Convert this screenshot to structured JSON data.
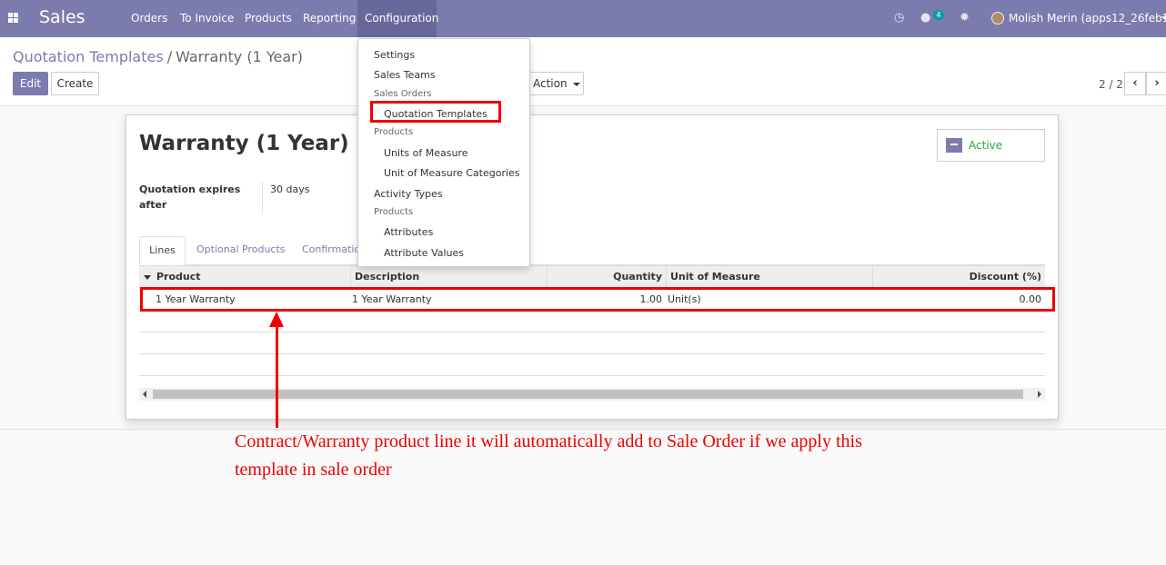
{
  "navbar": {
    "brand": "Sales",
    "menus": [
      "Orders",
      "To Invoice",
      "Products",
      "Reporting",
      "Configuration"
    ],
    "active_menu": "Configuration",
    "messages_count": "4",
    "user": "Molish Merin (apps12_26feb19)"
  },
  "breadcrumb": {
    "parent": "Quotation Templates",
    "separator": "/",
    "current": "Warranty (1 Year)"
  },
  "buttons": {
    "edit": "Edit",
    "create": "Create",
    "action": "Action"
  },
  "pager": {
    "value": "2 / 2",
    "prev": "‹",
    "next": "›"
  },
  "dropdown": {
    "items": [
      {
        "label": "Settings",
        "kind": "item"
      },
      {
        "label": "Sales Teams",
        "kind": "item"
      },
      {
        "label": "Sales Orders",
        "kind": "header"
      },
      {
        "label": "Quotation Templates",
        "kind": "sub"
      },
      {
        "label": "Products",
        "kind": "header"
      },
      {
        "label": "Units of Measure",
        "kind": "sub"
      },
      {
        "label": "Unit of Measure Categories",
        "kind": "sub"
      },
      {
        "label": "Activity Types",
        "kind": "item"
      },
      {
        "label": "Products",
        "kind": "header"
      },
      {
        "label": "Attributes",
        "kind": "sub"
      },
      {
        "label": "Attribute Values",
        "kind": "sub"
      }
    ]
  },
  "form": {
    "title": "Warranty (1 Year)",
    "status_button": "Active",
    "fields": [
      {
        "label": "Quotation expires after",
        "value": "30 days"
      }
    ],
    "tabs": [
      "Lines",
      "Optional Products",
      "Confirmatio"
    ],
    "table": {
      "columns": [
        "Product",
        "Description",
        "Quantity",
        "Unit of Measure",
        "Discount (%)"
      ],
      "rows": [
        {
          "product": "1 Year Warranty",
          "description": "1 Year Warranty",
          "quantity": "1.00",
          "uom": "Unit(s)",
          "discount": "0.00"
        }
      ]
    }
  },
  "annotation": {
    "text": "Contract/Warranty product line it will automatically add to Sale Order if we apply this template in sale order"
  },
  "colors": {
    "brand": "#7c7bad",
    "annotation": "#e00000",
    "active": "#28a745"
  }
}
